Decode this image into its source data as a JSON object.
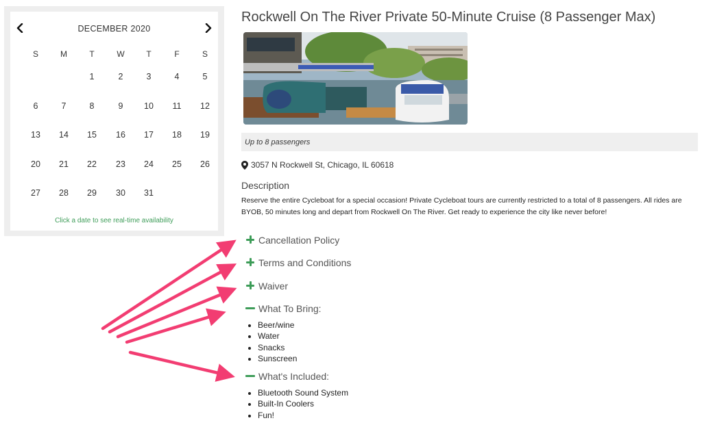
{
  "calendar": {
    "month_label": "DECEMBER 2020",
    "weekdays": [
      "S",
      "M",
      "T",
      "W",
      "T",
      "F",
      "S"
    ],
    "weeks": [
      [
        "",
        "",
        "1",
        "2",
        "3",
        "4",
        "5"
      ],
      [
        "6",
        "7",
        "8",
        "9",
        "10",
        "11",
        "12"
      ],
      [
        "13",
        "14",
        "15",
        "16",
        "17",
        "18",
        "19"
      ],
      [
        "20",
        "21",
        "22",
        "23",
        "24",
        "25",
        "26"
      ],
      [
        "27",
        "28",
        "29",
        "30",
        "31",
        "",
        ""
      ]
    ],
    "note": "Click a date to see real-time availability"
  },
  "listing": {
    "title": "Rockwell On The River Private 50-Minute Cruise (8 Passenger Max)",
    "caption": "Up to 8 passengers",
    "address": "3057 N Rockwell St, Chicago, IL 60618",
    "description_heading": "Description",
    "description": "Reserve the entire Cycleboat for a special occasion! Private Cycleboat tours are currently restricted to a total of 8 passengers. All rides are BYOB, 50 minutes long and depart from Rockwell On The River. Get ready to experience the city like never before!"
  },
  "sections": {
    "cancellation": "Cancellation Policy",
    "terms": "Terms and Conditions",
    "waiver": "Waiver",
    "bring": "What To Bring:",
    "included": "What's Included:"
  },
  "bring_items": [
    "Beer/wine",
    "Water",
    "Snacks",
    "Sunscreen"
  ],
  "included_items": [
    "Bluetooth Sound System",
    "Built-In Coolers",
    "Fun!"
  ],
  "colors": {
    "accent_green": "#3d9c58",
    "arrow_pink": "#f23d72",
    "caption_bg": "#efefef"
  },
  "icons": {
    "prev": "chevron-left-icon",
    "next": "chevron-right-icon",
    "location": "map-marker-icon",
    "expand": "plus-icon",
    "collapse": "minus-icon"
  }
}
